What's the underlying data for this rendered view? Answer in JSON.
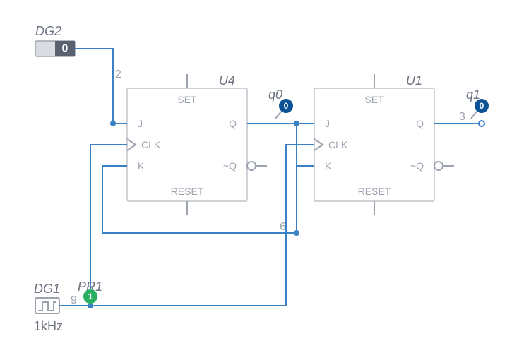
{
  "components": {
    "dg2": {
      "ref": "DG2",
      "value": "0"
    },
    "dg1": {
      "ref": "DG1",
      "freq": "1kHz"
    },
    "u4": {
      "ref": "U4",
      "pins": {
        "set": "SET",
        "reset": "RESET",
        "j": "J",
        "k": "K",
        "clk": "CLK",
        "q": "Q",
        "nq": "~Q"
      }
    },
    "u1": {
      "ref": "U1",
      "pins": {
        "set": "SET",
        "reset": "RESET",
        "j": "J",
        "k": "K",
        "clk": "CLK",
        "q": "Q",
        "nq": "~Q"
      }
    }
  },
  "probes": {
    "pr1": {
      "ref": "PR1",
      "value": "1"
    },
    "q0": {
      "ref": "q0",
      "value": "0"
    },
    "q1": {
      "ref": "q1",
      "value": "0"
    }
  },
  "nets": {
    "n2": "2",
    "n9": "9",
    "n6": "6",
    "n3": "3"
  }
}
